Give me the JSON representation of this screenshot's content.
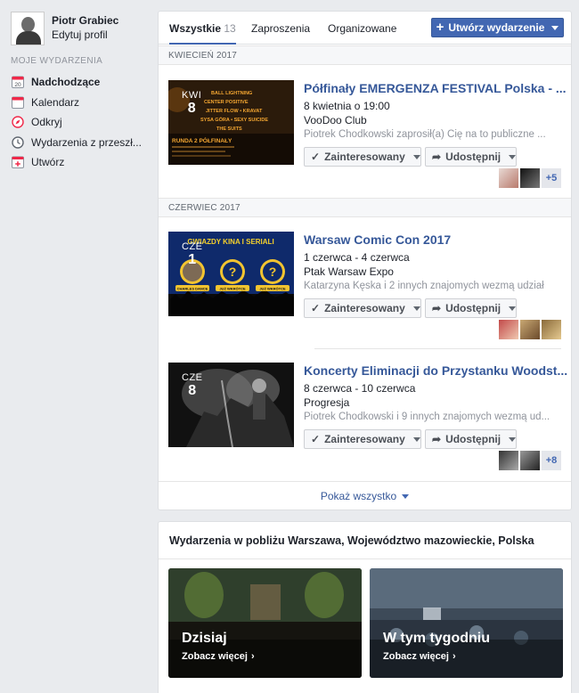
{
  "profile": {
    "name": "Piotr Grabiec",
    "edit_label": "Edytuj profil"
  },
  "sidebar": {
    "section_title": "MOJE WYDARZENIA",
    "items": [
      {
        "label": "Nadchodzące",
        "icon": "calendar-20-icon",
        "icon_text": "20",
        "active": true
      },
      {
        "label": "Kalendarz",
        "icon": "calendar-icon"
      },
      {
        "label": "Odkryj",
        "icon": "compass-icon"
      },
      {
        "label": "Wydarzenia z przeszł...",
        "icon": "clock-icon"
      },
      {
        "label": "Utwórz",
        "icon": "add-event-icon"
      }
    ]
  },
  "tabs": [
    {
      "label": "Wszystkie",
      "count": "13",
      "active": true
    },
    {
      "label": "Zaproszenia"
    },
    {
      "label": "Organizowane"
    }
  ],
  "create_button": {
    "label": "Utwórz wydarzenie"
  },
  "months": [
    "KWIECIEŃ 2017",
    "CZERWIEC 2017"
  ],
  "events": [
    {
      "badge_month": "KWI",
      "badge_day": "8",
      "title": "Półfinały EMERGENZA FESTIVAL Polska - ...",
      "date": "8 kwietnia o 19:00",
      "place": "VooDoo Club",
      "social": "Piotrek Chodkowski zaprosił(a) Cię na to publiczne ...",
      "interested_label": "Zainteresowany",
      "share_label": "Udostępnij",
      "more_count": "+5",
      "thumb_lines": [
        "BALL LIGHTNING",
        "CENTER POSITIVE",
        "JITTER FLOW • KRAVAT",
        "SYSA GÓRA • SEXY SUICIDE",
        "THE SUITS"
      ],
      "thumb_round": "RUNDA 2 PÓŁFINAŁY"
    },
    {
      "badge_month": "CZE",
      "badge_day": "1",
      "title": "Warsaw Comic Con 2017",
      "date": "1 czerwca - 4 czerwca",
      "place": "Ptak Warsaw Expo",
      "social": "Katarzyna Kęska i 2 innych znajomych wezmą udział",
      "interested_label": "Zainteresowany",
      "share_label": "Udostępnij",
      "more_count": "",
      "thumb_banner": "GWIAZDY KINA I SERIALI",
      "thumb_names": [
        "CHARLES DANCE",
        "JUŻ WKRÓTCE",
        "JUŻ WKRÓTCE"
      ]
    },
    {
      "badge_month": "CZE",
      "badge_day": "8",
      "title": "Koncerty Eliminacji do Przystanku Woodst...",
      "date": "8 czerwca - 10 czerwca",
      "place": "Progresja",
      "social": "Piotrek Chodkowski i 9 innych znajomych wezmą ud...",
      "interested_label": "Zainteresowany",
      "share_label": "Udostępnij",
      "more_count": "+8"
    }
  ],
  "show_all": {
    "label": "Pokaż wszystko"
  },
  "nearby": {
    "title": "Wydarzenia w pobliżu Warszawa, Województwo mazowieckie, Polska",
    "tiles": [
      {
        "label": "Dzisiaj",
        "link": "Zobacz więcej"
      },
      {
        "label": "W tym tygodniu",
        "link": "Zobacz więcej"
      }
    ]
  },
  "colors": {
    "brand": "#4267b2",
    "link": "#365899",
    "page_bg": "#e9ebee"
  }
}
